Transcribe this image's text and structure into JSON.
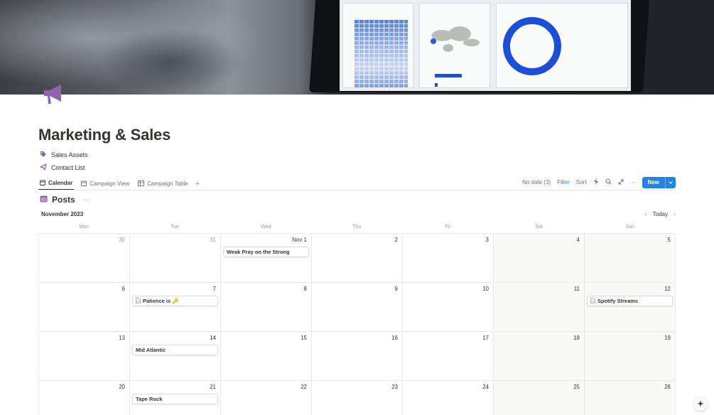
{
  "page": {
    "title": "Marketing & Sales",
    "icon": "megaphone-icon",
    "accent_color": "#9065b0"
  },
  "links": [
    {
      "label": "Sales Assets",
      "icon": "tag-icon"
    },
    {
      "label": "Contact List",
      "icon": "paper-plane-icon"
    }
  ],
  "tabs": [
    {
      "label": "Calendar",
      "icon": "calendar-icon",
      "active": true
    },
    {
      "label": "Campaign View",
      "icon": "calendar-icon",
      "active": false
    },
    {
      "label": "Campaign Table",
      "icon": "table-icon",
      "active": false
    }
  ],
  "toolbar": {
    "no_date": "No date (3)",
    "filter": "Filter",
    "sort": "Sort",
    "new": "New",
    "filter_color": "#2383e2",
    "new_color": "#2383e2"
  },
  "database": {
    "title": "Posts",
    "more": "···"
  },
  "calendar": {
    "month": "November 2023",
    "today": "Today",
    "weekdays": [
      "Mon",
      "Tue",
      "Wed",
      "Thu",
      "Fri",
      "Sat",
      "Sun"
    ],
    "weeks": [
      [
        {
          "day": "30",
          "muted": true
        },
        {
          "day": "31",
          "muted": true
        },
        {
          "day": "Nov 1",
          "event": "Weak Pray on the Strong"
        },
        {
          "day": "2"
        },
        {
          "day": "3"
        },
        {
          "day": "4"
        },
        {
          "day": "5"
        }
      ],
      [
        {
          "day": "6"
        },
        {
          "day": "7",
          "event": "Patience is 🔑",
          "doc": true
        },
        {
          "day": "8"
        },
        {
          "day": "9"
        },
        {
          "day": "10"
        },
        {
          "day": "11"
        },
        {
          "day": "12",
          "event": "Spotify Streams",
          "doc": true
        }
      ],
      [
        {
          "day": "13"
        },
        {
          "day": "14",
          "event": "Mid Atlantic"
        },
        {
          "day": "15"
        },
        {
          "day": "16"
        },
        {
          "day": "17"
        },
        {
          "day": "18"
        },
        {
          "day": "19"
        }
      ],
      [
        {
          "day": "20"
        },
        {
          "day": "21",
          "event": "Tape Rock"
        },
        {
          "day": "22"
        },
        {
          "day": "23"
        },
        {
          "day": "24"
        },
        {
          "day": "25"
        },
        {
          "day": "26"
        }
      ]
    ]
  }
}
